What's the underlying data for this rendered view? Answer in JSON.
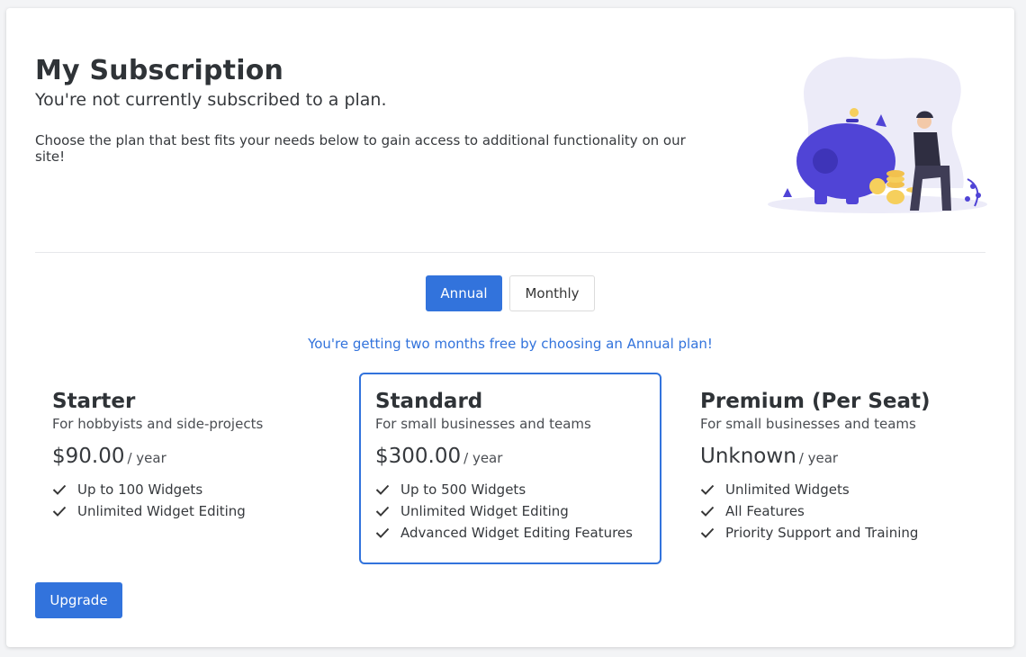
{
  "header": {
    "title": "My Subscription",
    "subtitle": "You're not currently subscribed to a plan.",
    "lead": "Choose the plan that best fits your needs below to gain access to additional functionality on our site!"
  },
  "billing_toggle": {
    "annual_label": "Annual",
    "monthly_label": "Monthly",
    "selected": "Annual"
  },
  "promo_text": "You're getting two months free by choosing an Annual plan!",
  "plans": [
    {
      "name": "Starter",
      "description": "For hobbyists and side-projects",
      "price": "$90.00",
      "period": "/ year",
      "features": [
        "Up to 100 Widgets",
        "Unlimited Widget Editing"
      ]
    },
    {
      "name": "Standard",
      "description": "For small businesses and teams",
      "price": "$300.00",
      "period": "/ year",
      "selected": true,
      "features": [
        "Up to 500 Widgets",
        "Unlimited Widget Editing",
        "Advanced Widget Editing Features"
      ]
    },
    {
      "name": "Premium (Per Seat)",
      "description": "For small businesses and teams",
      "price": "Unknown",
      "period": "/ year",
      "features": [
        "Unlimited Widgets",
        "All Features",
        "Priority Support and Training"
      ]
    }
  ],
  "upgrade_label": "Upgrade",
  "colors": {
    "accent": "#3273dc",
    "illustration_primary": "#5044d6",
    "illustration_bg": "#ecebf8",
    "coin": "#f6cf5c"
  },
  "icons": {
    "feature": "check-icon",
    "illustration": "piggy-bank-illustration"
  }
}
